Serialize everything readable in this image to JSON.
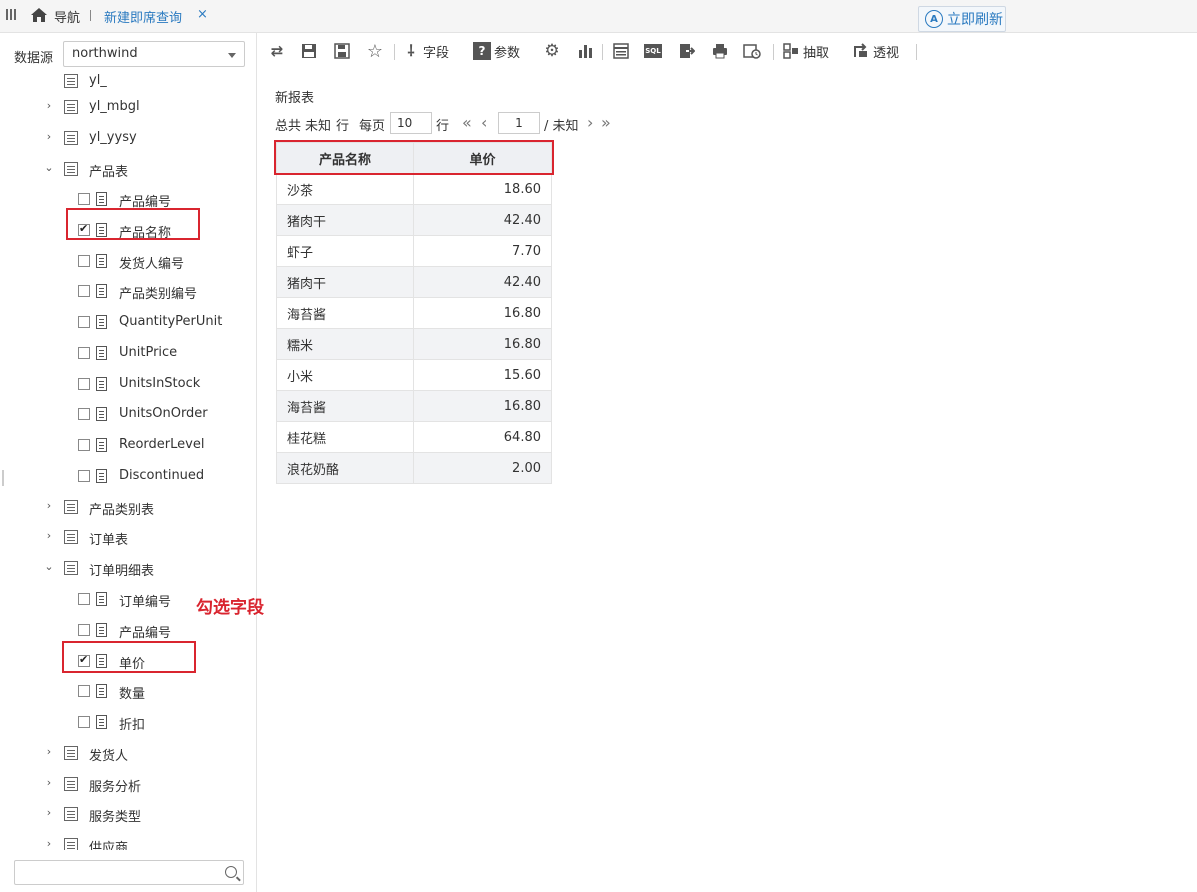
{
  "nav": {
    "home_label": "导航",
    "active_tab": "新建即席查询",
    "close_glyph": "×"
  },
  "left": {
    "datasource_label": "数据源",
    "datasource_value": "northwind",
    "tree": [
      {
        "label": "yl_",
        "type": "partial"
      },
      {
        "label": "yl_mbgl",
        "type": "table",
        "expanded": false
      },
      {
        "label": "yl_yysy",
        "type": "table",
        "expanded": false
      },
      {
        "label": "产品表",
        "type": "table",
        "expanded": true
      },
      {
        "label": "产品编号",
        "type": "field",
        "checked": false
      },
      {
        "label": "产品名称",
        "type": "field",
        "checked": true
      },
      {
        "label": "发货人编号",
        "type": "field",
        "checked": false
      },
      {
        "label": "产品类别编号",
        "type": "field",
        "checked": false
      },
      {
        "label": "QuantityPerUnit",
        "type": "field",
        "checked": false
      },
      {
        "label": "UnitPrice",
        "type": "field",
        "checked": false
      },
      {
        "label": "UnitsInStock",
        "type": "field",
        "checked": false
      },
      {
        "label": "UnitsOnOrder",
        "type": "field",
        "checked": false
      },
      {
        "label": "ReorderLevel",
        "type": "field",
        "checked": false
      },
      {
        "label": "Discontinued",
        "type": "field",
        "checked": false
      },
      {
        "label": "产品类别表",
        "type": "table",
        "expanded": false
      },
      {
        "label": "订单表",
        "type": "table",
        "expanded": false
      },
      {
        "label": "订单明细表",
        "type": "table",
        "expanded": true
      },
      {
        "label": "订单编号",
        "type": "field",
        "checked": false
      },
      {
        "label": "产品编号",
        "type": "field",
        "checked": false
      },
      {
        "label": "单价",
        "type": "field",
        "checked": true
      },
      {
        "label": "数量",
        "type": "field",
        "checked": false
      },
      {
        "label": "折扣",
        "type": "field",
        "checked": false
      },
      {
        "label": "发货人",
        "type": "table",
        "expanded": false
      },
      {
        "label": "服务分析",
        "type": "table",
        "expanded": false
      },
      {
        "label": "服务类型",
        "type": "table",
        "expanded": false
      },
      {
        "label": "供应商",
        "type": "table",
        "expanded": false
      }
    ],
    "annotation": "勾选字段",
    "search_placeholder": ""
  },
  "toolbar": {
    "fields_label": "字段",
    "params_label": "参数",
    "extract_label": "抽取",
    "pivot_label": "透视",
    "refresh_label": "立即刷新",
    "sql_label": "SQL"
  },
  "report": {
    "title": "新报表",
    "total_prefix": "总共",
    "total_value": "未知",
    "rows_unit": "行",
    "per_page_label": "每页",
    "per_page_value": "10",
    "per_page_unit": "行",
    "page_value": "1",
    "page_total": "/ 未知",
    "columns": [
      "产品名称",
      "单价"
    ],
    "rows": [
      [
        "沙茶",
        "18.60"
      ],
      [
        "猪肉干",
        "42.40"
      ],
      [
        "虾子",
        "7.70"
      ],
      [
        "猪肉干",
        "42.40"
      ],
      [
        "海苔酱",
        "16.80"
      ],
      [
        "糯米",
        "16.80"
      ],
      [
        "小米",
        "15.60"
      ],
      [
        "海苔酱",
        "16.80"
      ],
      [
        "桂花糕",
        "64.80"
      ],
      [
        "浪花奶酪",
        "2.00"
      ]
    ]
  }
}
